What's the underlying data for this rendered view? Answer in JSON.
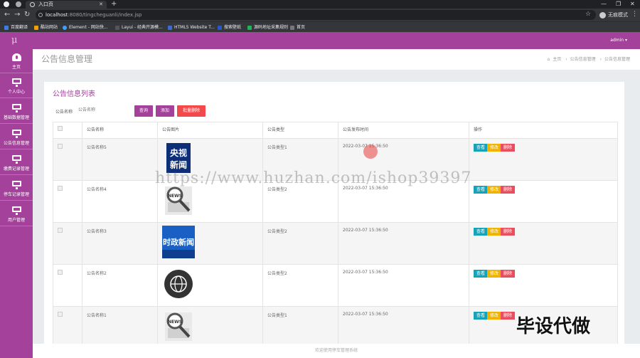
{
  "browser": {
    "tab_title": "入口页",
    "url_host": "localhost",
    "url_path": ":8080/tingcheguanli/index.jsp",
    "incognito_label": "无痕模式",
    "bookmarks": [
      "百度翻译",
      "酷站网站",
      "Element - 网站快...",
      "Layui - 经典开源模...",
      "HTML5 Website T...",
      "搜索壁纸",
      "源码地址采集规则",
      "首页"
    ]
  },
  "app": {
    "logo": "μ",
    "user_menu": "admin ▾"
  },
  "sidebar": {
    "items": [
      {
        "label": "主页",
        "icon": "dashboard-icon"
      },
      {
        "label": "个人中心",
        "icon": "monitor-icon"
      },
      {
        "label": "基础数据管理",
        "icon": "monitor-icon"
      },
      {
        "label": "公告信息管理",
        "icon": "monitor-icon"
      },
      {
        "label": "缴费记录管理",
        "icon": "monitor-icon"
      },
      {
        "label": "停车记录管理",
        "icon": "monitor-icon"
      },
      {
        "label": "用户管理",
        "icon": "monitor-icon"
      }
    ]
  },
  "header": {
    "title": "公告信息管理",
    "breadcrumbs": [
      "主页",
      "公告信息管理",
      "公告信息管理"
    ]
  },
  "card": {
    "title": "公告信息列表",
    "search_label": "公告名称",
    "search_placeholder": "公告名称",
    "query_button": "查询",
    "add_button": "添加",
    "batch_delete_button": "批量删除"
  },
  "table": {
    "columns": [
      "公告名称",
      "公告图片",
      "公告类型",
      "公告发布时间",
      "操作"
    ],
    "rows": [
      {
        "name": "公告名称5",
        "type": "公告类型1",
        "time": "2022-03-07 15:36:50",
        "image": "cctv-news"
      },
      {
        "name": "公告名称4",
        "type": "公告类型2",
        "time": "2022-03-07 15:36:50",
        "image": "news-magnifier"
      },
      {
        "name": "公告名称3",
        "type": "公告类型2",
        "time": "2022-03-07 15:36:50",
        "image": "politics-news"
      },
      {
        "name": "公告名称2",
        "type": "公告类型2",
        "time": "2022-03-07 15:36:50",
        "image": "globe-news"
      },
      {
        "name": "公告名称1",
        "type": "公告类型1",
        "time": "2022-03-07 15:36:50",
        "image": "news-magnifier"
      }
    ],
    "actions": {
      "view": "查看",
      "edit": "修改",
      "delete": "删除"
    }
  },
  "footer": {
    "text": "欢迎使用停车管理系统"
  },
  "overlay": {
    "watermark": "https://www.huzhan.com/ishop39397",
    "corner_brand": "毕设代做"
  },
  "colors": {
    "brand": "#a3419b",
    "danger": "#f2494b",
    "view": "#17a2b8",
    "edit": "#f0b400"
  }
}
